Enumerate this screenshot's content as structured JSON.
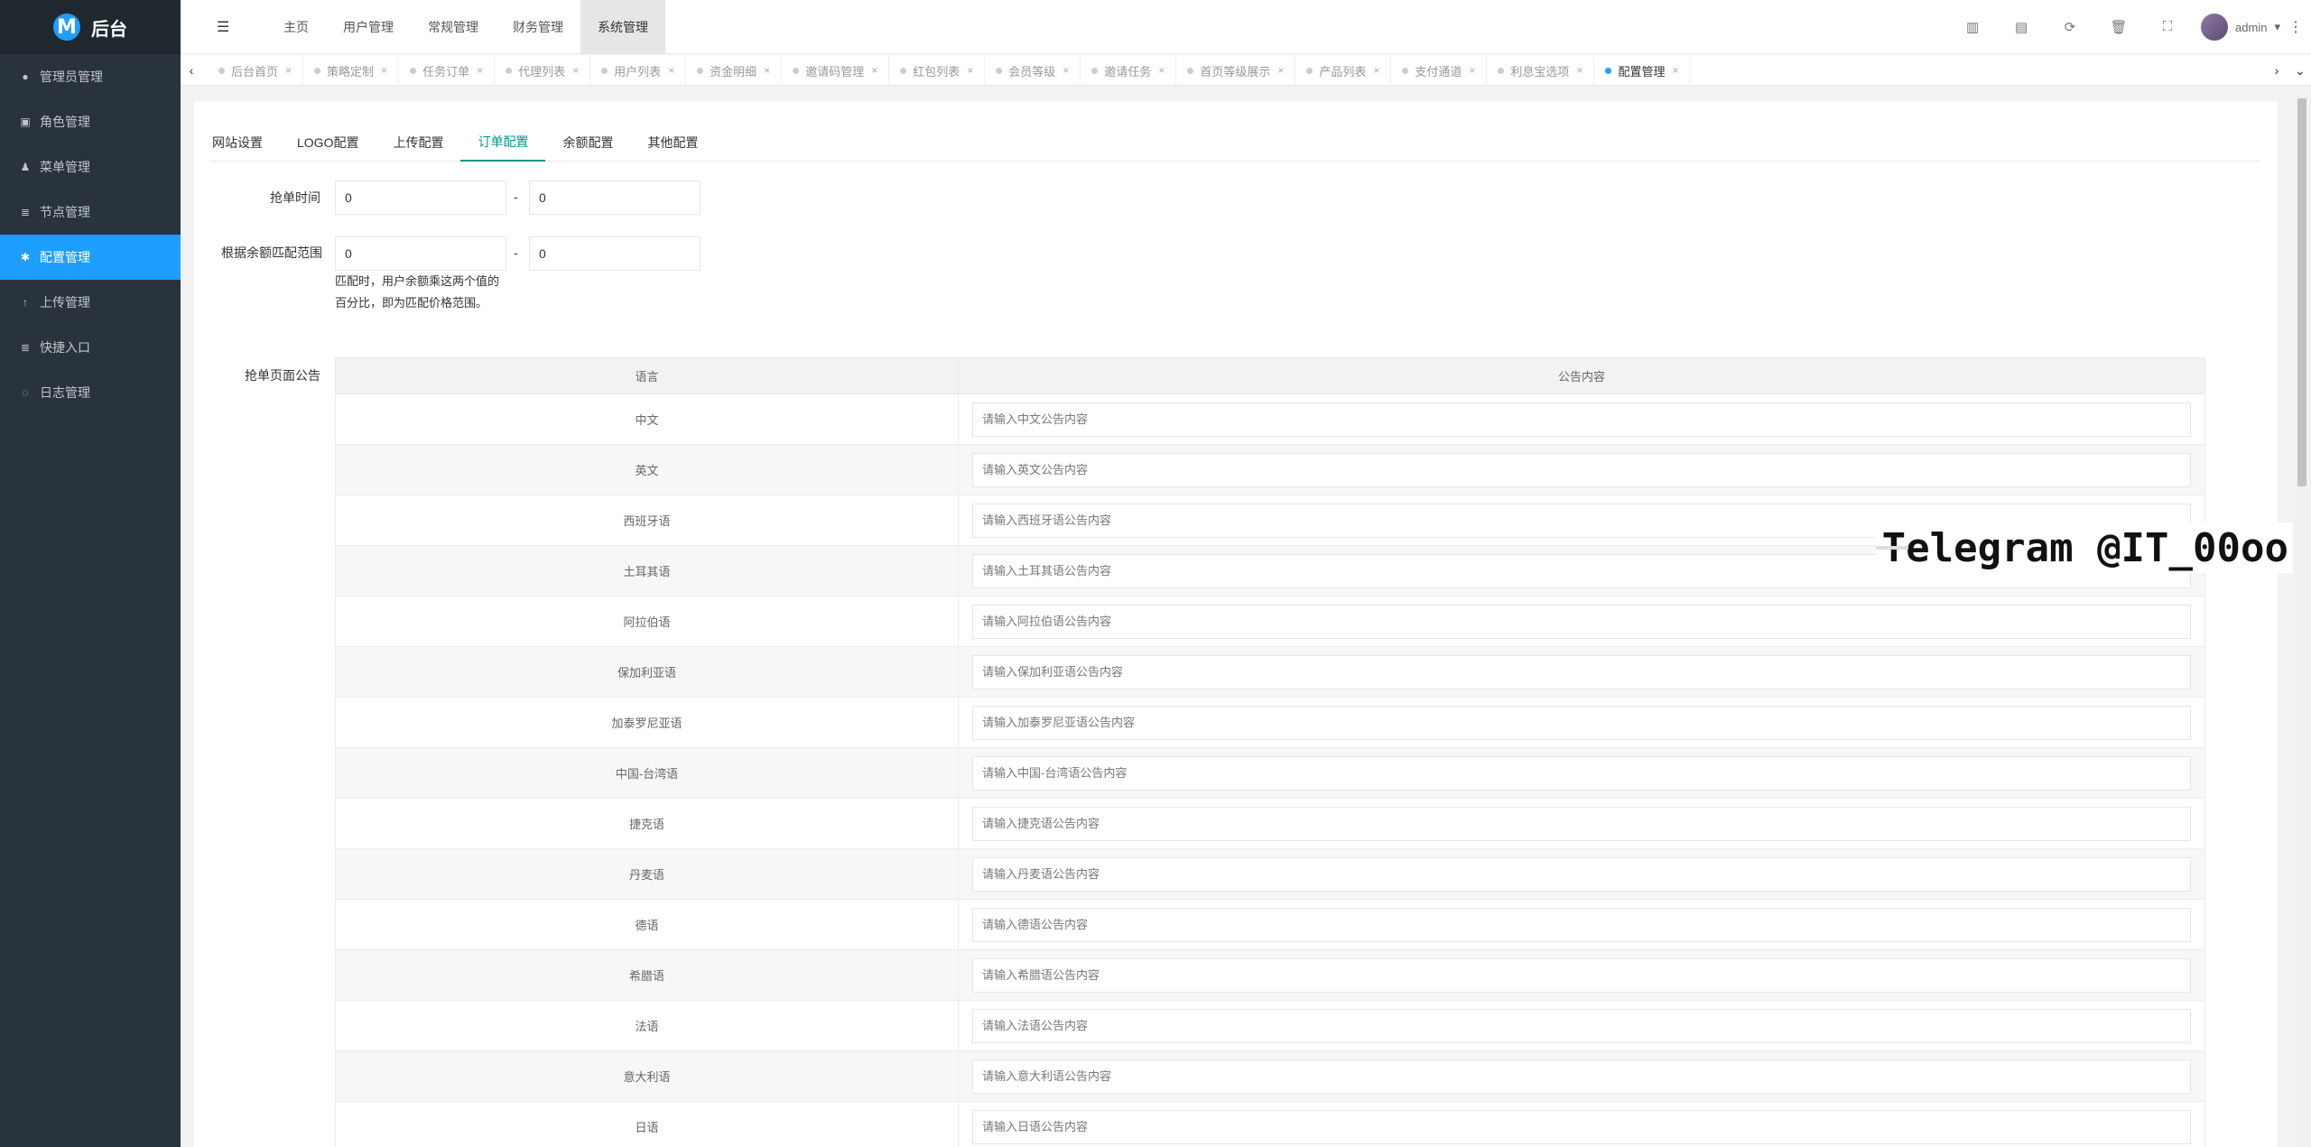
{
  "app": {
    "logo_letter": "M",
    "title": "后台"
  },
  "sidebar": {
    "items": [
      {
        "label": "管理员管理",
        "icon": "person-icon",
        "glyph": "●"
      },
      {
        "label": "角色管理",
        "icon": "id-card-icon",
        "glyph": "▣"
      },
      {
        "label": "菜单管理",
        "icon": "bell-icon",
        "glyph": "♟"
      },
      {
        "label": "节点管理",
        "icon": "list-icon",
        "glyph": "≣"
      },
      {
        "label": "配置管理",
        "icon": "gear-icon",
        "glyph": "✱",
        "active": true
      },
      {
        "label": "上传管理",
        "icon": "upload-icon",
        "glyph": "↑"
      },
      {
        "label": "快捷入口",
        "icon": "list-icon",
        "glyph": "≣"
      },
      {
        "label": "日志管理",
        "icon": "log-icon",
        "glyph": "◌"
      }
    ]
  },
  "header": {
    "nav": [
      "主页",
      "用户管理",
      "常规管理",
      "财务管理",
      "系统管理"
    ],
    "active_nav": "系统管理",
    "tools": [
      {
        "name": "chart-icon",
        "glyph": "▥"
      },
      {
        "name": "card-icon",
        "glyph": "▤"
      },
      {
        "name": "refresh-icon",
        "glyph": "⟳"
      },
      {
        "name": "trash-icon",
        "glyph": "🗑"
      },
      {
        "name": "fullscreen-icon",
        "glyph": "⛶"
      }
    ],
    "user": "admin",
    "user_caret": "▾",
    "more": "⋮"
  },
  "tabs": {
    "items": [
      "后台首页",
      "策略定制",
      "任务订单",
      "代理列表",
      "用户列表",
      "资金明细",
      "邀请码管理",
      "红包列表",
      "会员等级",
      "邀请任务",
      "首页等级展示",
      "产品列表",
      "支付通道",
      "利息宝选项",
      "配置管理"
    ],
    "active": "配置管理",
    "close_glyph": "×",
    "left_arrow": "‹",
    "right_arrow": "›",
    "down_arrow": "⌄"
  },
  "config": {
    "subtabs": [
      "网站设置",
      "LOGO配置",
      "上传配置",
      "订单配置",
      "余额配置",
      "其他配置"
    ],
    "active_subtab": "订单配置",
    "grab_time": {
      "label": "抢单时间",
      "from": "0",
      "to": "0",
      "dash": "-"
    },
    "balance_range": {
      "label": "根据余额匹配范围",
      "from": "0",
      "to": "0",
      "dash": "-",
      "hint": "匹配时，用户余额乘这两个值的百分比，即为匹配价格范围。"
    },
    "announcement": {
      "label": "抢单页面公告",
      "columns": [
        "语言",
        "公告内容"
      ],
      "rows": [
        {
          "lang": "中文",
          "placeholder": "请输入中文公告内容"
        },
        {
          "lang": "英文",
          "placeholder": "请输入英文公告内容"
        },
        {
          "lang": "西班牙语",
          "placeholder": "请输入西班牙语公告内容"
        },
        {
          "lang": "土耳其语",
          "placeholder": "请输入土耳其语公告内容"
        },
        {
          "lang": "阿拉伯语",
          "placeholder": "请输入阿拉伯语公告内容"
        },
        {
          "lang": "保加利亚语",
          "placeholder": "请输入保加利亚语公告内容"
        },
        {
          "lang": "加泰罗尼亚语",
          "placeholder": "请输入加泰罗尼亚语公告内容"
        },
        {
          "lang": "中国-台湾语",
          "placeholder": "请输入中国-台湾语公告内容"
        },
        {
          "lang": "捷克语",
          "placeholder": "请输入捷克语公告内容"
        },
        {
          "lang": "丹麦语",
          "placeholder": "请输入丹麦语公告内容"
        },
        {
          "lang": "德语",
          "placeholder": "请输入德语公告内容"
        },
        {
          "lang": "希腊语",
          "placeholder": "请输入希腊语公告内容"
        },
        {
          "lang": "法语",
          "placeholder": "请输入法语公告内容"
        },
        {
          "lang": "意大利语",
          "placeholder": "请输入意大利语公告内容"
        },
        {
          "lang": "日语",
          "placeholder": "请输入日语公告内容"
        }
      ]
    }
  },
  "watermark": "Telegram @IT_00oo",
  "colors": {
    "sidebar_bg": "#28333e",
    "accent": "#1e9fff",
    "subtab_active": "#009688"
  }
}
